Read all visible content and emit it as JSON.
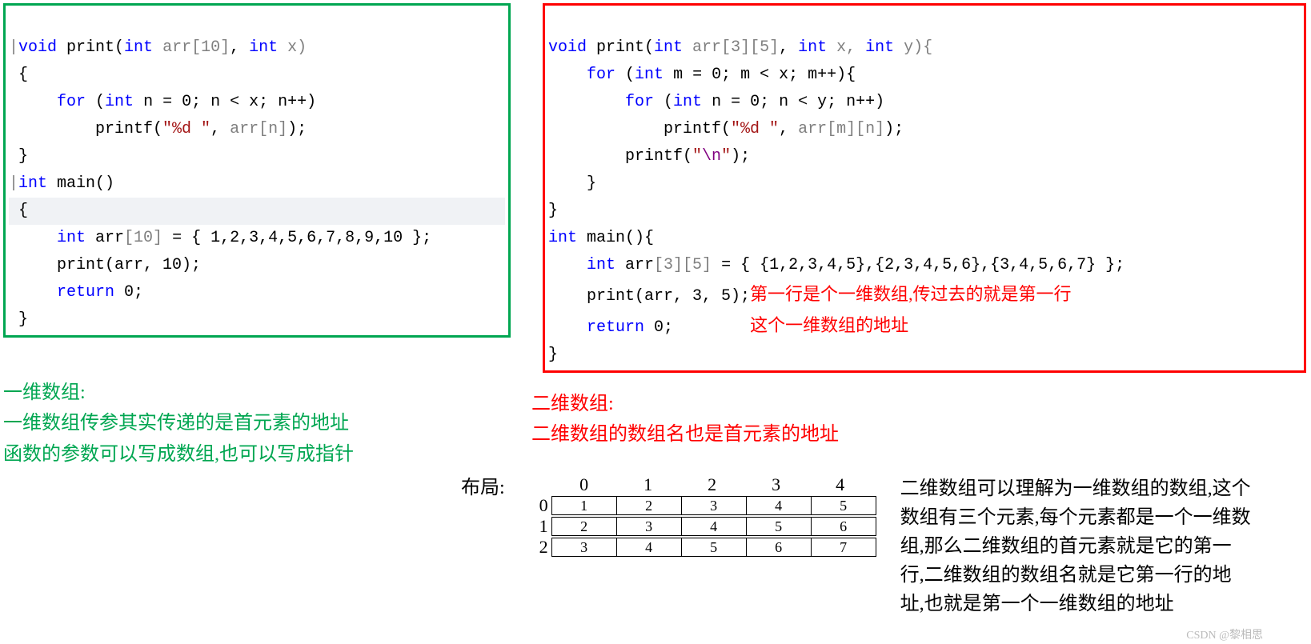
{
  "left_code": {
    "l1_pre": "|",
    "l1_kw1": "void",
    "l1_fn": " print(",
    "l1_kw2": "int",
    "l1_arr": " arr",
    "l1_dim1": "[10]",
    "l1_c1": ", ",
    "l1_kw3": "int",
    "l1_x": " x)",
    "l2": " {",
    "l3a": "     ",
    "l3_kw1": "for",
    "l3b": " (",
    "l3_kw2": "int",
    "l3c": " n = 0; n < x; n++)",
    "l4a": "         printf(",
    "l4_str": "\"%d \"",
    "l4b": ", ",
    "l4_dim": "arr[n]",
    "l4c": ");",
    "l5": " }",
    "l6_pre": "|",
    "l6_kw": "int",
    "l6_fn": " main()",
    "l7": " {",
    "l8a": "     ",
    "l8_kw": "int",
    "l8b": " arr",
    "l8_dim": "[10]",
    "l8c": " = { 1,2,3,4,5,6,7,8,9,10 };",
    "l9a": "     print(arr, 10);",
    "l10a": "     ",
    "l10_kw": "return",
    "l10b": " 0;",
    "l11": " }"
  },
  "right_code": {
    "l1_kw1": "void",
    "l1_fn": " print(",
    "l1_kw2": "int",
    "l1_arr": " arr",
    "l1_dim": "[3][5]",
    "l1_c1": ", ",
    "l1_kw3": "int",
    "l1_x": " x, ",
    "l1_kw4": "int",
    "l1_y": " y){",
    "l2a": "    ",
    "l2_kw1": "for",
    "l2b": " (",
    "l2_kw2": "int",
    "l2c": " m = 0; m < x; m++){",
    "l3a": "        ",
    "l3_kw1": "for",
    "l3b": " (",
    "l3_kw2": "int",
    "l3c": " n = 0; n < y; n++)",
    "l4a": "            printf(",
    "l4_str": "\"%d \"",
    "l4b": ", ",
    "l4_dim": "arr[m][n]",
    "l4c": ");",
    "l5a": "        printf(",
    "l5_str1": "\"",
    "l5_esc": "\\n",
    "l5_str2": "\"",
    "l5b": ");",
    "l6": "    }",
    "l7": "}",
    "l8_kw": "int",
    "l8_fn": " main(){",
    "l9a": "    ",
    "l9_kw": "int",
    "l9b": " arr",
    "l9_dim": "[3][5]",
    "l9c": " = { {1,2,3,4,5},{2,3,4,5,6},{3,4,5,6,7} };",
    "l10": "    print(arr, 3, 5);",
    "l11a": "    ",
    "l11_kw": "return",
    "l11b": " 0;",
    "l12": "}",
    "annot1": "第一行是个一维数组,传过去的就是第一行",
    "annot2": "这个一维数组的地址"
  },
  "notes_left": {
    "t1": "一维数组:",
    "t2": "一维数组传参其实传递的是首元素的地址",
    "t3": "函数的参数可以写成数组,也可以写成指针"
  },
  "notes_right": {
    "t1": "二维数组:",
    "t2": "二维数组的数组名也是首元素的地址"
  },
  "layout": {
    "label": "布局:",
    "col_headers": [
      "0",
      "1",
      "2",
      "3",
      "4"
    ],
    "row_headers": [
      "0",
      "1",
      "2"
    ],
    "rows": [
      [
        "1",
        "2",
        "3",
        "4",
        "5"
      ],
      [
        "2",
        "3",
        "4",
        "5",
        "6"
      ],
      [
        "3",
        "4",
        "5",
        "6",
        "7"
      ]
    ]
  },
  "explain": "二维数组可以理解为一维数组的数组,这个数组有三个元素,每个元素都是一个一维数组,那么二维数组的首元素就是它的第一行,二维数组的数组名就是它第一行的地址,也就是第一个一维数组的地址",
  "watermark": "CSDN @黎相思"
}
